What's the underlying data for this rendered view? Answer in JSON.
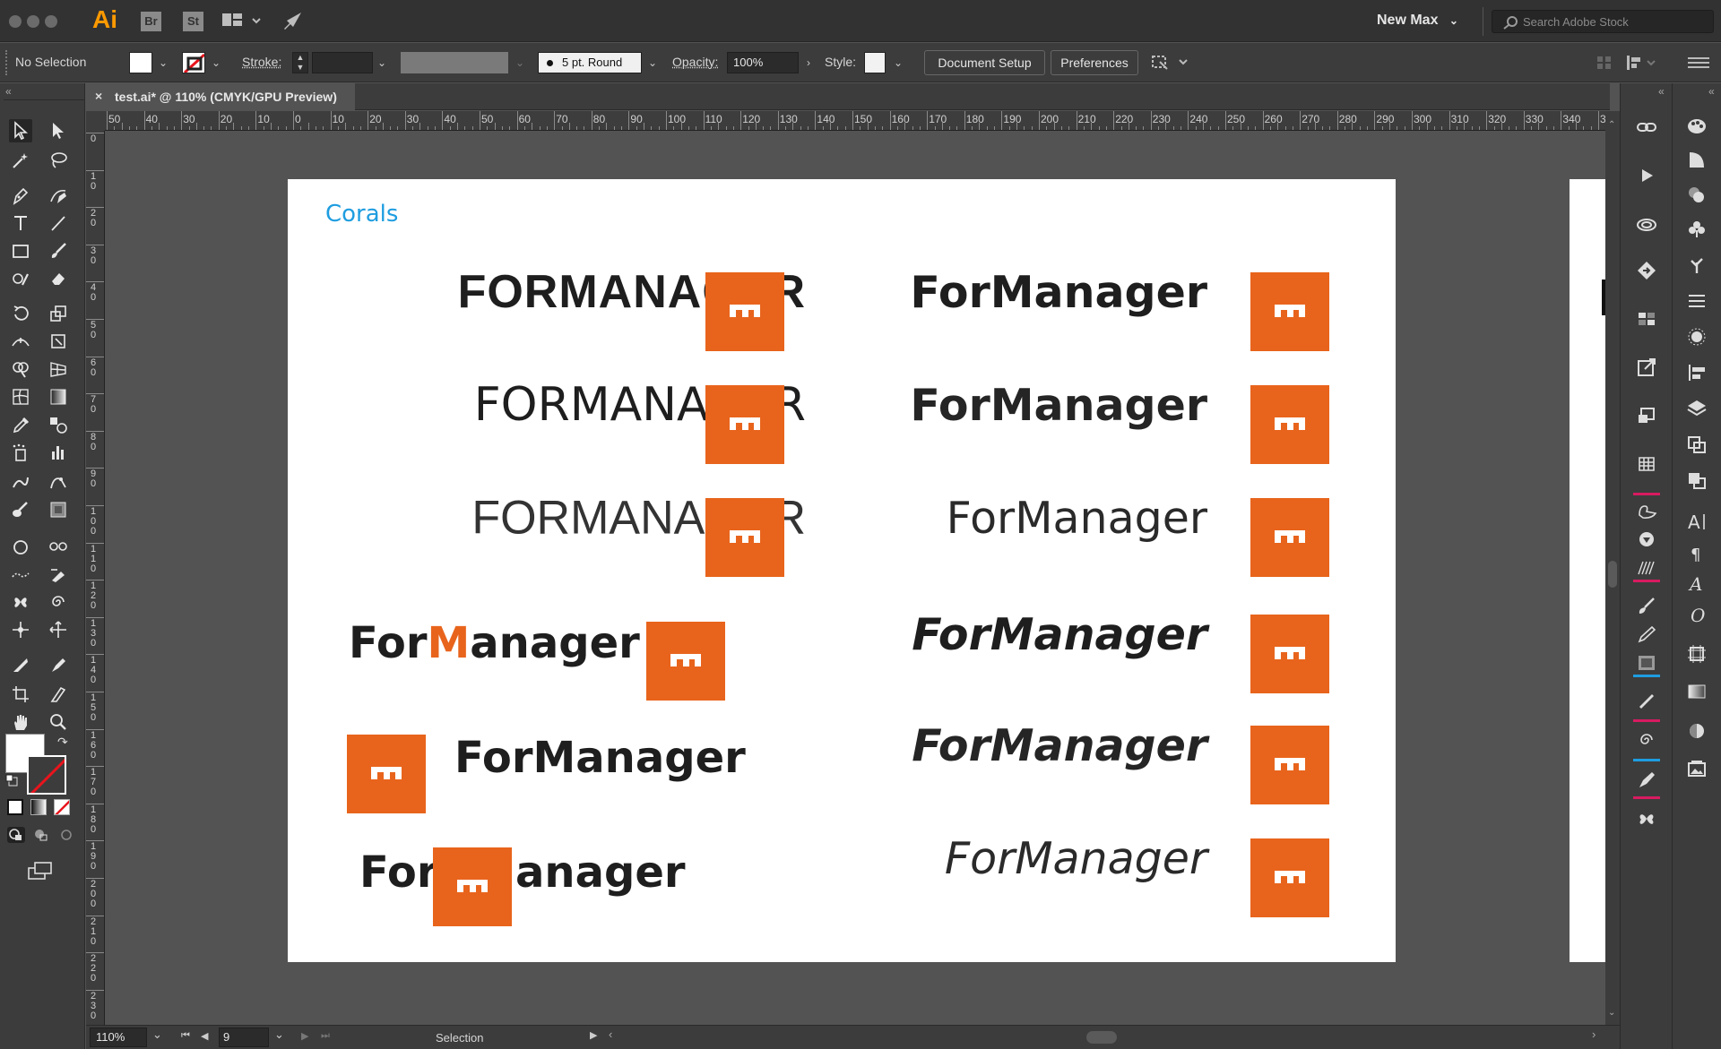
{
  "app": {
    "logo": "Ai",
    "bridge_label": "Br",
    "stock_app_label": "St",
    "workspace": "New Max",
    "stock_search_placeholder": "Search Adobe Stock"
  },
  "control_bar": {
    "selection_status": "No Selection",
    "stroke_label": "Stroke:",
    "brush_value": "5 pt. Round",
    "opacity_label": "Opacity:",
    "opacity_value": "100%",
    "style_label": "Style:",
    "document_setup": "Document Setup",
    "preferences": "Preferences"
  },
  "document_tab": {
    "close": "×",
    "title": "test.ai* @ 110% (CMYK/GPU Preview)"
  },
  "ruler": {
    "horizontal_ticks": [
      "50",
      "40",
      "30",
      "20",
      "10",
      "0",
      "10",
      "20",
      "30",
      "40",
      "50",
      "60",
      "70",
      "80",
      "90",
      "100",
      "110",
      "120",
      "130",
      "140",
      "150",
      "160",
      "170",
      "180",
      "190",
      "200",
      "210",
      "220",
      "230",
      "240",
      "250",
      "260",
      "270",
      "280",
      "290",
      "300",
      "310",
      "320",
      "330",
      "340",
      "3"
    ],
    "vertical_ticks": [
      "0",
      "10",
      "20",
      "30",
      "40",
      "50",
      "60",
      "70",
      "80",
      "90",
      "100",
      "110",
      "120",
      "130",
      "140",
      "150",
      "160",
      "170",
      "180",
      "190",
      "200",
      "210",
      "220",
      "230"
    ]
  },
  "status_bar": {
    "zoom": "110%",
    "artboard_number": "9",
    "tool_status": "Selection"
  },
  "artwork": {
    "title": "Corals",
    "wordmark_upper": "FORMANAGER",
    "wordmark_mixed": "ForManager",
    "split_prefix": "For",
    "split_letter": "M",
    "split_suffix": "anager",
    "brand_orange": "#e8641c",
    "title_blue": "#1e9de0"
  }
}
